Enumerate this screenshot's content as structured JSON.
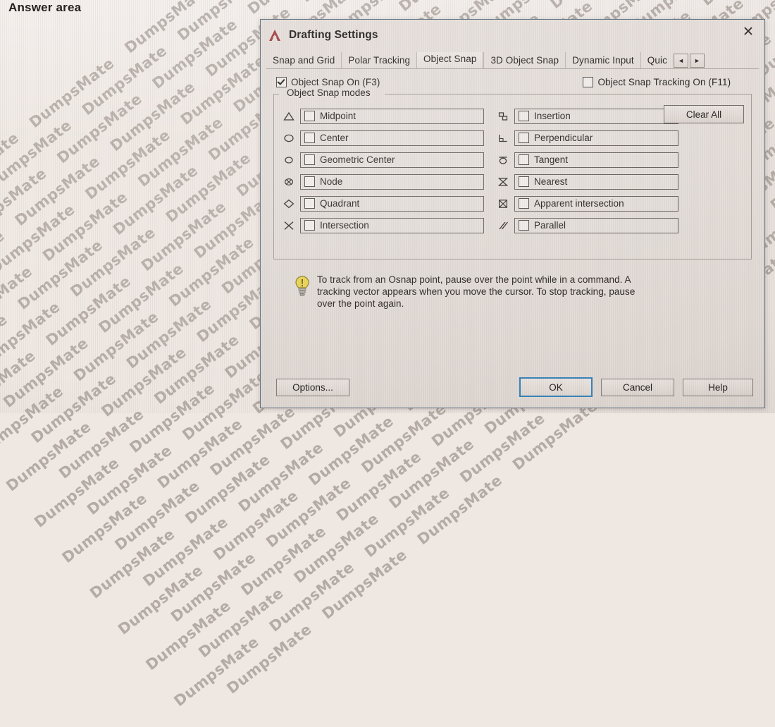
{
  "page": {
    "answer_area_label": "Answer area",
    "watermark_text": "DumpsMate"
  },
  "dialog": {
    "title": "Drafting Settings",
    "logo_icon": "autocad-a-icon",
    "logo_color": "#9e3b3b",
    "close_icon": "close-icon",
    "border_color": "#5c6f80",
    "tabs": [
      {
        "label": "Snap and Grid",
        "active": false
      },
      {
        "label": "Polar Tracking",
        "active": false
      },
      {
        "label": "Object Snap",
        "active": true
      },
      {
        "label": "3D Object Snap",
        "active": false
      },
      {
        "label": "Dynamic Input",
        "active": false
      },
      {
        "label": "Quic",
        "active": false
      }
    ],
    "tab_scroll": {
      "left_icon": "chevron-left-icon",
      "left_label": "◄",
      "right_icon": "chevron-right-icon",
      "right_label": "►"
    },
    "top_options": [
      {
        "label": "Object Snap On (F3)",
        "checked": true
      },
      {
        "label": "Object Snap Tracking On (F11)",
        "checked": false
      }
    ],
    "snap_modes_group": {
      "title": "Object Snap modes",
      "clear_all_label": "Clear All",
      "left_column": [
        {
          "label": "Midpoint",
          "checked": false,
          "icon": "triangle-icon"
        },
        {
          "label": "Center",
          "checked": false,
          "icon": "circle-icon"
        },
        {
          "label": "Geometric Center",
          "checked": false,
          "icon": "small-circle-icon"
        },
        {
          "label": "Node",
          "checked": false,
          "icon": "circle-x-icon"
        },
        {
          "label": "Quadrant",
          "checked": false,
          "icon": "diamond-icon"
        },
        {
          "label": "Intersection",
          "checked": false,
          "icon": "x-cross-icon"
        }
      ],
      "right_column": [
        {
          "label": "Insertion",
          "checked": false,
          "icon": "insertion-icon"
        },
        {
          "label": "Perpendicular",
          "checked": false,
          "icon": "perpendicular-icon"
        },
        {
          "label": "Tangent",
          "checked": false,
          "icon": "tangent-icon"
        },
        {
          "label": "Nearest",
          "checked": false,
          "icon": "nearest-hourglass-icon"
        },
        {
          "label": "Apparent intersection",
          "checked": false,
          "icon": "square-x-icon"
        },
        {
          "label": "Parallel",
          "checked": false,
          "icon": "parallel-slashes-icon"
        }
      ]
    },
    "tip": {
      "icon": "lightbulb-icon",
      "text": "To track from an Osnap point, pause over the point while in a command.  A tracking vector appears when you move the cursor.  To stop tracking, pause over the point again."
    },
    "footer": {
      "options_label": "Options...",
      "ok_label": "OK",
      "cancel_label": "Cancel",
      "help_label": "Help",
      "ok_focus_color": "#2f7db5"
    }
  }
}
